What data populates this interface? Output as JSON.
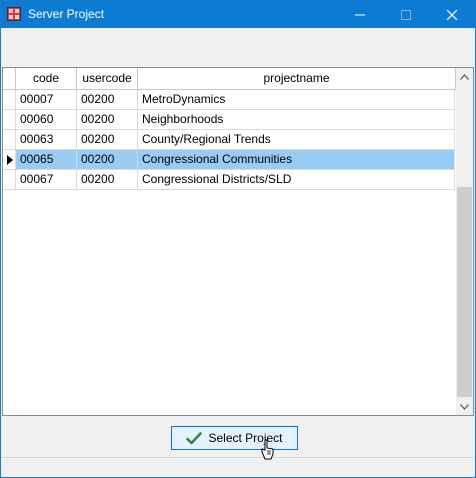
{
  "window": {
    "title": "Server Project",
    "icon": "grid-app-icon",
    "controls": [
      "minimize-icon",
      "maximize-icon",
      "close-icon"
    ],
    "titlebar_color": "#0c7bd4"
  },
  "grid": {
    "columns": [
      {
        "label": "code"
      },
      {
        "label": "usercode"
      },
      {
        "label": "projectname"
      }
    ],
    "rows": [
      {
        "code": "00007",
        "usercode": "00200",
        "projectname": "MetroDynamics",
        "selected": false
      },
      {
        "code": "00060",
        "usercode": "00200",
        "projectname": "Neighborhoods",
        "selected": false
      },
      {
        "code": "00063",
        "usercode": "00200",
        "projectname": "County/Regional Trends",
        "selected": false
      },
      {
        "code": "00065",
        "usercode": "00200",
        "projectname": "Congressional Communities",
        "selected": true
      },
      {
        "code": "00067",
        "usercode": "00200",
        "projectname": "Congressional Districts/SLD",
        "selected": false
      }
    ],
    "selection_color": "#99ccf5"
  },
  "actions": {
    "select_label": "Select Project",
    "select_icon": "checkmark-icon",
    "accent": "#0078d7"
  }
}
